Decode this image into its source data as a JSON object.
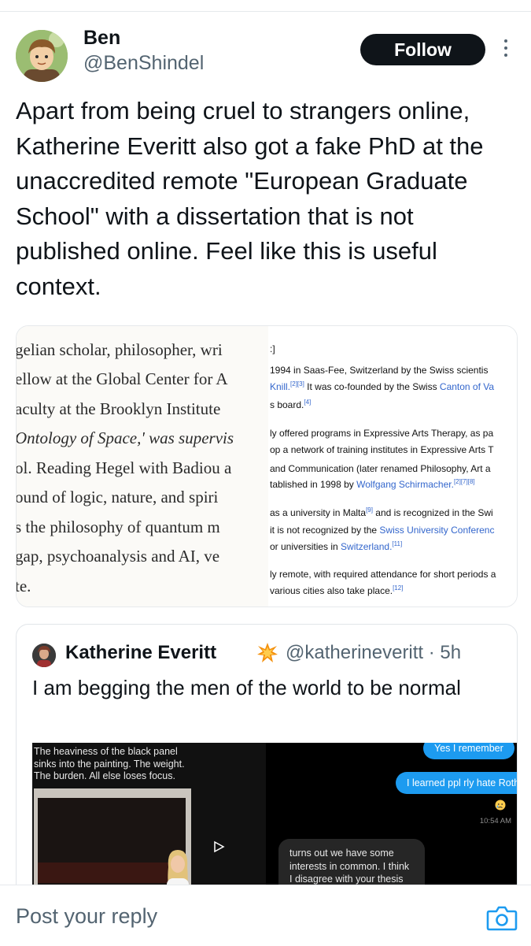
{
  "author": {
    "name": "Ben",
    "handle": "@BenShindel",
    "follow_label": "Follow",
    "avatar_icon": "cartoon-avatar-icon",
    "more_icon": "more-vertical-icon"
  },
  "tweet": {
    "text": "Apart from being cruel to strangers online, Katherine Everitt also got a fake PhD at the unaccredited remote \"European Graduate School\" with a dissertation that is not published online. Feel like this is useful context."
  },
  "media": {
    "left_lines": [
      "gelian scholar, philosopher, wri",
      "ellow at the Global Center for A",
      "aculty at the Brooklyn Institute",
      "Ontology of Space,' was supervis",
      "ol. Reading Hegel with Badiou a",
      "ound of logic, nature, and spiri",
      "s the philosophy of quantum m",
      "gap, psychoanalysis and AI, ve",
      "te."
    ],
    "right_lines": [
      {
        "parts": [
          {
            "t": ":]",
            "link": false
          }
        ]
      },
      {
        "parts": [
          {
            "t": "1994 in Saas-Fee, Switzerland by the Swiss scientis",
            "link": false
          }
        ]
      },
      {
        "parts": [
          {
            "t": "Knill.",
            "link": true
          },
          {
            "t": "[2][3]",
            "link": true,
            "sup": true
          },
          {
            "t": " It was co-founded by the Swiss ",
            "link": false
          },
          {
            "t": "Canton of Va",
            "link": true
          }
        ]
      },
      {
        "parts": [
          {
            "t": "s board.",
            "link": false
          },
          {
            "t": "[4]",
            "link": true,
            "sup": true
          }
        ]
      },
      {
        "parts": [
          {
            "t": "ly offered programs in Expressive Arts Therapy, as pa",
            "link": false
          }
        ]
      },
      {
        "parts": [
          {
            "t": "op a network of training institutes in Expressive Arts T",
            "link": false
          }
        ]
      },
      {
        "parts": [
          {
            "t": " and Communication (later renamed Philosophy, Art a",
            "link": false
          }
        ]
      },
      {
        "parts": [
          {
            "t": "tablished in 1998 by ",
            "link": false
          },
          {
            "t": "Wolfgang Schirmacher.",
            "link": true
          },
          {
            "t": "[2][7][8]",
            "link": true,
            "sup": true
          }
        ]
      },
      {
        "parts": [
          {
            "t": "as a university in Malta",
            "link": false
          },
          {
            "t": "[9]",
            "link": true,
            "sup": true
          },
          {
            "t": " and is recognized in the Swi",
            "link": false
          }
        ]
      },
      {
        "parts": [
          {
            "t": "it is not recognized by the ",
            "link": false
          },
          {
            "t": "Swiss University Conferenc",
            "link": true
          }
        ]
      },
      {
        "parts": [
          {
            "t": "or universities in ",
            "link": false
          },
          {
            "t": "Switzerland.",
            "link": true
          },
          {
            "t": "[11]",
            "link": true,
            "sup": true
          }
        ]
      },
      {
        "parts": [
          {
            "t": "ly remote, with required attendance for short periods a",
            "link": false
          }
        ]
      },
      {
        "parts": [
          {
            "t": "various cities also take place.",
            "link": false
          },
          {
            "t": "[12]",
            "link": true,
            "sup": true
          }
        ]
      }
    ]
  },
  "quote": {
    "name": "Katherine Everitt",
    "emoji_icon": "collision-emoji-icon",
    "handle_time": "@katherineveritt · 5h",
    "text": "I am begging the men of the world to be normal",
    "left_caption": "The heaviness of the black panel sinks into the painting. The weight. The burden. All else loses focus.",
    "chat_1": "Yes I remember",
    "chat_2": "I learned ppl rly hate Rothko",
    "chat_time": "10:54 AM",
    "chat_3": "turns out we have some interests in common. I think I disagree with your thesis here"
  },
  "reply": {
    "placeholder": "Post your reply",
    "camera_icon": "camera-icon"
  },
  "colors": {
    "accent": "#1d9bf0",
    "text": "#0f1419",
    "secondary": "#536471",
    "follow_bg": "#0f1419"
  }
}
